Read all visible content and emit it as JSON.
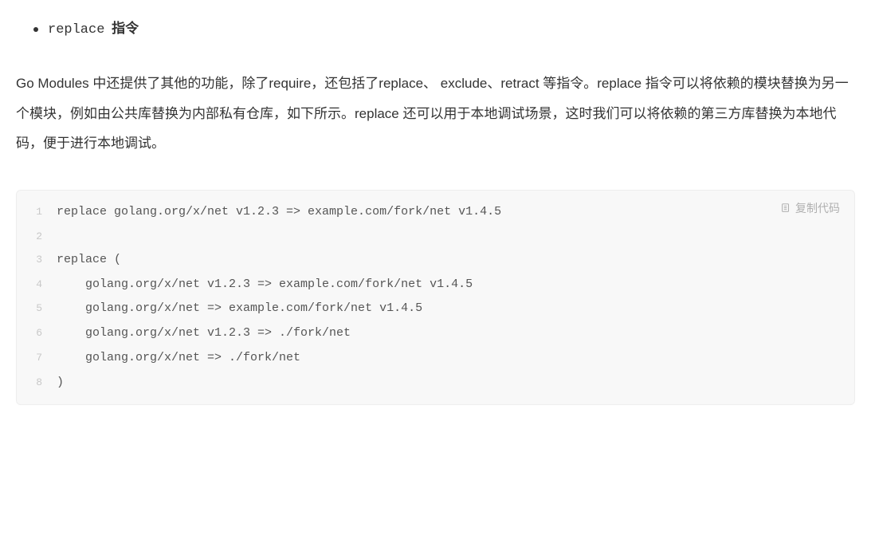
{
  "bullet": {
    "code": "replace",
    "label": " 指令"
  },
  "paragraph": {
    "text": "Go Modules 中还提供了其他的功能，除了require，还包括了replace、 exclude、retract 等指令。replace 指令可以将依赖的模块替换为另一个模块，例如由公共库替换为内部私有仓库，如下所示。replace 还可以用于本地调试场景，这时我们可以将依赖的第三方库替换为本地代码，便于进行本地调试。"
  },
  "codeBlock": {
    "copyLabel": "复制代码",
    "lines": [
      "replace golang.org/x/net v1.2.3 => example.com/fork/net v1.4.5",
      "",
      "replace (",
      "    golang.org/x/net v1.2.3 => example.com/fork/net v1.4.5",
      "    golang.org/x/net => example.com/fork/net v1.4.5",
      "    golang.org/x/net v1.2.3 => ./fork/net",
      "    golang.org/x/net => ./fork/net",
      ")"
    ]
  }
}
